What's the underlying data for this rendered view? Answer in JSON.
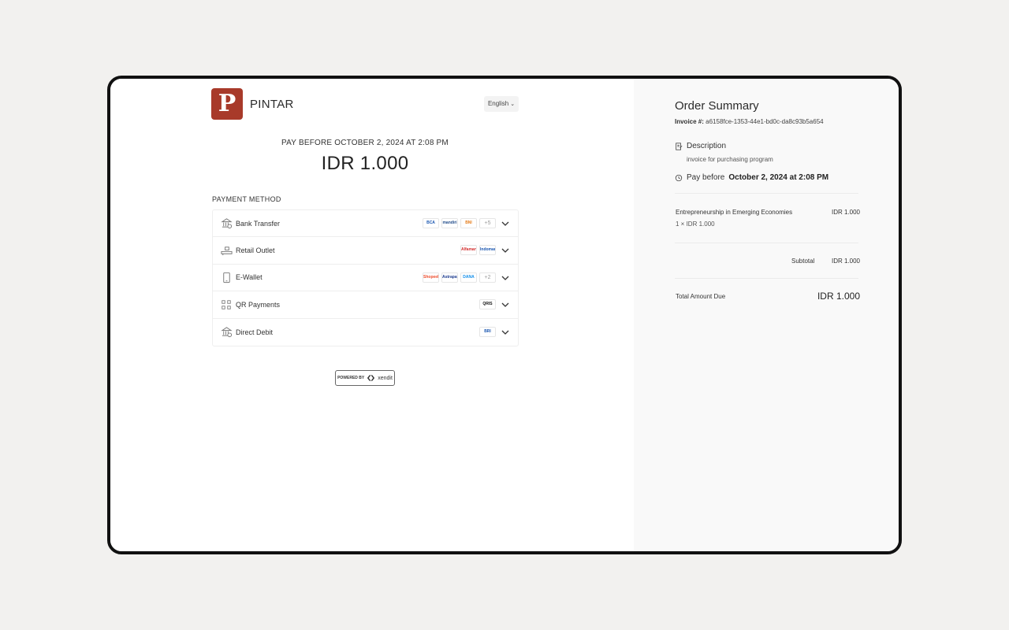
{
  "header": {
    "brand_initial": "P",
    "brand_name": "PINTAR",
    "language": "English"
  },
  "payment": {
    "pay_before": "PAY BEFORE OCTOBER 2, 2024 AT 2:08 PM",
    "amount": "IDR 1.000",
    "method_label": "PAYMENT METHOD",
    "methods": [
      {
        "label": "Bank Transfer",
        "logos": [
          "BCA",
          "mandiri",
          "BNI"
        ],
        "more": "+5"
      },
      {
        "label": "Retail Outlet",
        "logos": [
          "Alfamart",
          "Indomaret"
        ],
        "more": ""
      },
      {
        "label": "E-Wallet",
        "logos": [
          "ShopeePay",
          "Astrapay",
          "DANA"
        ],
        "more": "+2"
      },
      {
        "label": "QR Payments",
        "logos": [
          "QRIS"
        ],
        "more": ""
      },
      {
        "label": "Direct Debit",
        "logos": [
          "BRI"
        ],
        "more": ""
      }
    ],
    "powered_by": "POWERED BY",
    "provider": "xendit"
  },
  "summary": {
    "title": "Order Summary",
    "invoice_label": "Invoice #:",
    "invoice_id": "a6158fce-1353-44e1-bd0c-da8c93b5a654",
    "description_label": "Description",
    "description_text": "invoice for purchasing program",
    "pay_before_prefix": "Pay before",
    "pay_before_date": "October 2, 2024 at 2:08 PM",
    "item_name": "Entrepreneurship in Emerging Economies",
    "item_price": "IDR 1.000",
    "item_qty": "1 × IDR 1.000",
    "subtotal_label": "Subtotal",
    "subtotal_value": "IDR 1.000",
    "total_label": "Total Amount Due",
    "total_value": "IDR 1.000"
  },
  "colors": {
    "brand": "#a83a2a",
    "frame": "#111111",
    "background": "#f2f1ef"
  }
}
